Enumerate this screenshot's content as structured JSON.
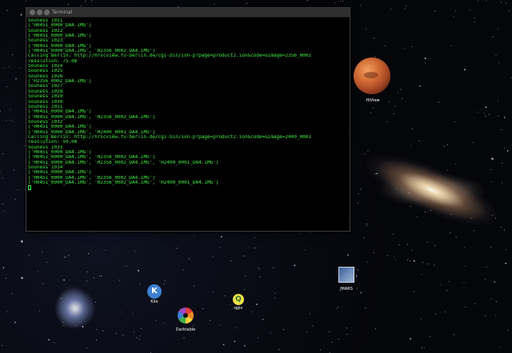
{
  "terminal": {
    "title": "Terminal",
    "lines": [
      "Souness 1021",
      "['H0451_0000_DA4.IMG']",
      "Souness 1022",
      "['H0451_0000_DA4.IMG']",
      "Souness 1023",
      "['H0451_0000_DA4.IMG']",
      "['H0451_0000_DA4.IMG', 'H2356_0002_DA4.IMG']",
      "Calling Berlin: http://hrscview.fu-berlin.de/cgi-bin/ion-p?page=product2.ion&code=&image=2356_0002",
      "resolution: 75.0m",
      "Souness 1024",
      "Souness 1025",
      "Souness 1026",
      "['H2356_0002_DA4.IMG']",
      "Souness 1027",
      "Souness 1028",
      "Souness 1029",
      "Souness 1030",
      "Souness 1031",
      "['H0451_0000_DA4.IMG']",
      "['H0451_0000_DA4.IMG', 'H2356_0002_DA4.IMG']",
      "Souness 1032",
      "['H0451_0000_DA4.IMG']",
      "['H0451_0000_DA4.IMG', 'H2400_0001_DA4.IMG']",
      "Calling Berlin: http://hrscview.fu-berlin.de/cgi-bin/ion-p?page=product2.ion&code=&image=2400_0001",
      "resolution: 50.0m",
      "Souness 1033",
      "['H0451_0000_DA4.IMG']",
      "['H0451_0000_DA4.IMG', 'H2356_0002_DA4.IMG']",
      "['H0451_0000_DA4.IMG', 'H2356_0002_DA4.IMG', 'H2400_0001_DA4.IMG']",
      "Souness 1034",
      "['H0451_0000_DA4.IMG']",
      "['H0451_0000_DA4.IMG', 'H2356_0002_DA4.IMG']",
      "['H0451_0000_DA4.IMG', 'H2356_0002_DA4.IMG', 'H2400_0001_DA4.IMG']"
    ]
  },
  "desktop_icons": {
    "hiview": {
      "label": "HiView",
      "icon": "mars-planet-icon"
    },
    "kile": {
      "label": "Kile",
      "icon": "kile-icon",
      "glyph": "K"
    },
    "qgis": {
      "label": "qgis",
      "icon": "qgis-icon",
      "glyph": "Q"
    },
    "jmars": {
      "label": "JMARS",
      "icon": "jmars-icon"
    },
    "darktable": {
      "label": "Darktable",
      "icon": "darktable-icon"
    }
  },
  "colors": {
    "terminal_text": "#42f042",
    "terminal_bg": "#000000",
    "titlebar": "#2e2e2e"
  }
}
